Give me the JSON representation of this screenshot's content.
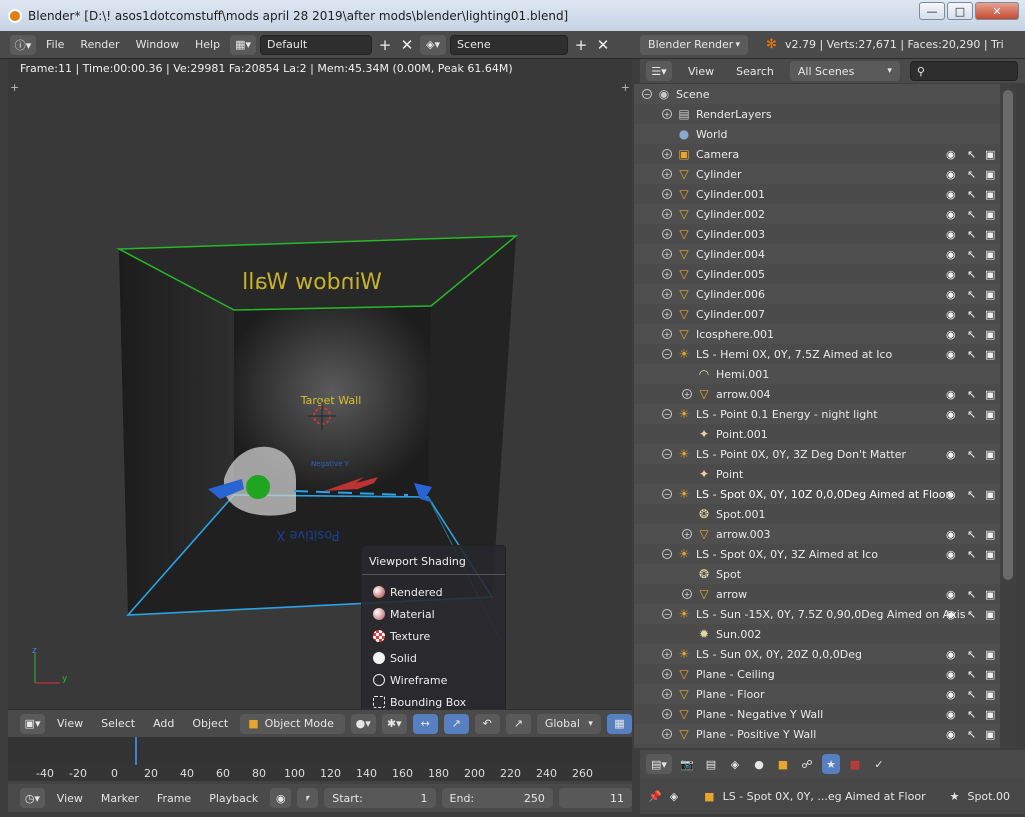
{
  "window": {
    "title": "Blender* [D:\\! asos1dotcomstuff\\mods april 28 2019\\after mods\\blender\\lighting01.blend]"
  },
  "topbar": {
    "menus": [
      "File",
      "Render",
      "Window",
      "Help"
    ],
    "screen_layout": "Default",
    "scene": "Scene",
    "engine": "Blender Render",
    "stats": "v2.79 | Verts:27,671 | Faces:20,290 | Tri"
  },
  "viewport": {
    "info": "Frame:11 | Time:00:00.36 | Ve:29981 Fa:20854 La:2 | Mem:45.34M (0.00M, Peak 61.64M)",
    "labels": {
      "window_wall": "Window Wall",
      "target_wall": "Target Wall",
      "negative_y": "Negative Y",
      "positive_x": "Positive X"
    },
    "menu": [
      "View",
      "Select",
      "Add",
      "Object"
    ],
    "mode": "Object Mode",
    "orientation": "Global"
  },
  "shading_popup": {
    "title": "Viewport Shading",
    "options": [
      "Rendered",
      "Material",
      "Texture",
      "Solid",
      "Wireframe",
      "Bounding Box"
    ]
  },
  "timeline": {
    "ticks": [
      "-40",
      "-20",
      "0",
      "20",
      "40",
      "60",
      "80",
      "100",
      "120",
      "140",
      "160",
      "180",
      "200",
      "220",
      "240",
      "260"
    ],
    "current_frame_fraction": 0.203,
    "menu": [
      "View",
      "Marker",
      "Frame",
      "Playback"
    ],
    "start_label": "Start:",
    "start_value": "1",
    "end_label": "End:",
    "end_value": "250",
    "current": "11"
  },
  "outliner": {
    "menu": [
      "View",
      "Search"
    ],
    "filter": "All Scenes",
    "rows": [
      {
        "label": "Scene",
        "indent": 0,
        "icon": "scene",
        "expand": "open"
      },
      {
        "label": "RenderLayers",
        "indent": 1,
        "icon": "renderlayers",
        "expand": "closed"
      },
      {
        "label": "World",
        "indent": 1,
        "icon": "world",
        "expand": "none"
      },
      {
        "label": "Camera",
        "indent": 1,
        "icon": "camera",
        "expand": "closed",
        "vis": true
      },
      {
        "label": "Cylinder",
        "indent": 1,
        "icon": "mesh",
        "expand": "closed",
        "vis": true
      },
      {
        "label": "Cylinder.001",
        "indent": 1,
        "icon": "mesh",
        "expand": "closed",
        "vis": true
      },
      {
        "label": "Cylinder.002",
        "indent": 1,
        "icon": "mesh",
        "expand": "closed",
        "vis": true
      },
      {
        "label": "Cylinder.003",
        "indent": 1,
        "icon": "mesh",
        "expand": "closed",
        "vis": true
      },
      {
        "label": "Cylinder.004",
        "indent": 1,
        "icon": "mesh",
        "expand": "closed",
        "vis": true
      },
      {
        "label": "Cylinder.005",
        "indent": 1,
        "icon": "mesh",
        "expand": "closed",
        "vis": true
      },
      {
        "label": "Cylinder.006",
        "indent": 1,
        "icon": "mesh",
        "expand": "closed",
        "vis": true
      },
      {
        "label": "Cylinder.007",
        "indent": 1,
        "icon": "mesh",
        "expand": "closed",
        "vis": true
      },
      {
        "label": "Icosphere.001",
        "indent": 1,
        "icon": "mesh",
        "expand": "closed",
        "vis": true
      },
      {
        "label": "LS - Hemi 0X, 0Y, 7.5Z Aimed at Ico",
        "indent": 1,
        "icon": "lamp",
        "expand": "open",
        "vis": true
      },
      {
        "label": "Hemi.001",
        "indent": 2,
        "icon": "hemi",
        "expand": "none"
      },
      {
        "label": "arrow.004",
        "indent": 2,
        "icon": "mesh",
        "expand": "closed",
        "vis": true
      },
      {
        "label": "LS - Point 0.1 Energy - night light",
        "indent": 1,
        "icon": "lamp",
        "expand": "open",
        "vis": true
      },
      {
        "label": "Point.001",
        "indent": 2,
        "icon": "point",
        "expand": "none"
      },
      {
        "label": "LS - Point 0X, 0Y, 3Z Deg Don't Matter",
        "indent": 1,
        "icon": "lamp",
        "expand": "open",
        "vis": true
      },
      {
        "label": "Point",
        "indent": 2,
        "icon": "point",
        "expand": "none"
      },
      {
        "label": "LS - Spot 0X, 0Y, 10Z 0,0,0Deg Aimed at Floor",
        "indent": 1,
        "icon": "lamp",
        "expand": "open",
        "vis": true,
        "active": true
      },
      {
        "label": "Spot.001",
        "indent": 2,
        "icon": "spot",
        "expand": "none"
      },
      {
        "label": "arrow.003",
        "indent": 2,
        "icon": "mesh",
        "expand": "closed",
        "vis": true
      },
      {
        "label": "LS - Spot 0X, 0Y, 3Z Aimed at Ico",
        "indent": 1,
        "icon": "lamp",
        "expand": "open",
        "vis": true
      },
      {
        "label": "Spot",
        "indent": 2,
        "icon": "spot",
        "expand": "none"
      },
      {
        "label": "arrow",
        "indent": 2,
        "icon": "mesh",
        "expand": "closed",
        "vis": true
      },
      {
        "label": "LS - Sun -15X, 0Y, 7.5Z 0,90,0Deg Aimed on Axis",
        "indent": 1,
        "icon": "lamp",
        "expand": "open",
        "vis": true
      },
      {
        "label": "Sun.002",
        "indent": 2,
        "icon": "sun",
        "expand": "none"
      },
      {
        "label": "LS - Sun 0X, 0Y, 20Z 0,0,0Deg",
        "indent": 1,
        "icon": "lamp",
        "expand": "closed",
        "vis": true
      },
      {
        "label": "Plane - Ceiling",
        "indent": 1,
        "icon": "mesh",
        "expand": "closed",
        "vis": true
      },
      {
        "label": "Plane - Floor",
        "indent": 1,
        "icon": "mesh",
        "expand": "closed",
        "vis": true
      },
      {
        "label": "Plane - Negative Y Wall",
        "indent": 1,
        "icon": "mesh",
        "expand": "closed",
        "vis": true
      },
      {
        "label": "Plane - Positive Y Wall",
        "indent": 1,
        "icon": "mesh",
        "expand": "closed",
        "vis": true
      }
    ]
  },
  "properties": {
    "path_object": "LS - Spot 0X, 0Y, ...eg Aimed at Floor",
    "path_data": "Spot.00"
  },
  "colors": {
    "accent": "#e87d0d",
    "selection_green": "#2fb52f",
    "selection_blue": "#29a3e6"
  }
}
